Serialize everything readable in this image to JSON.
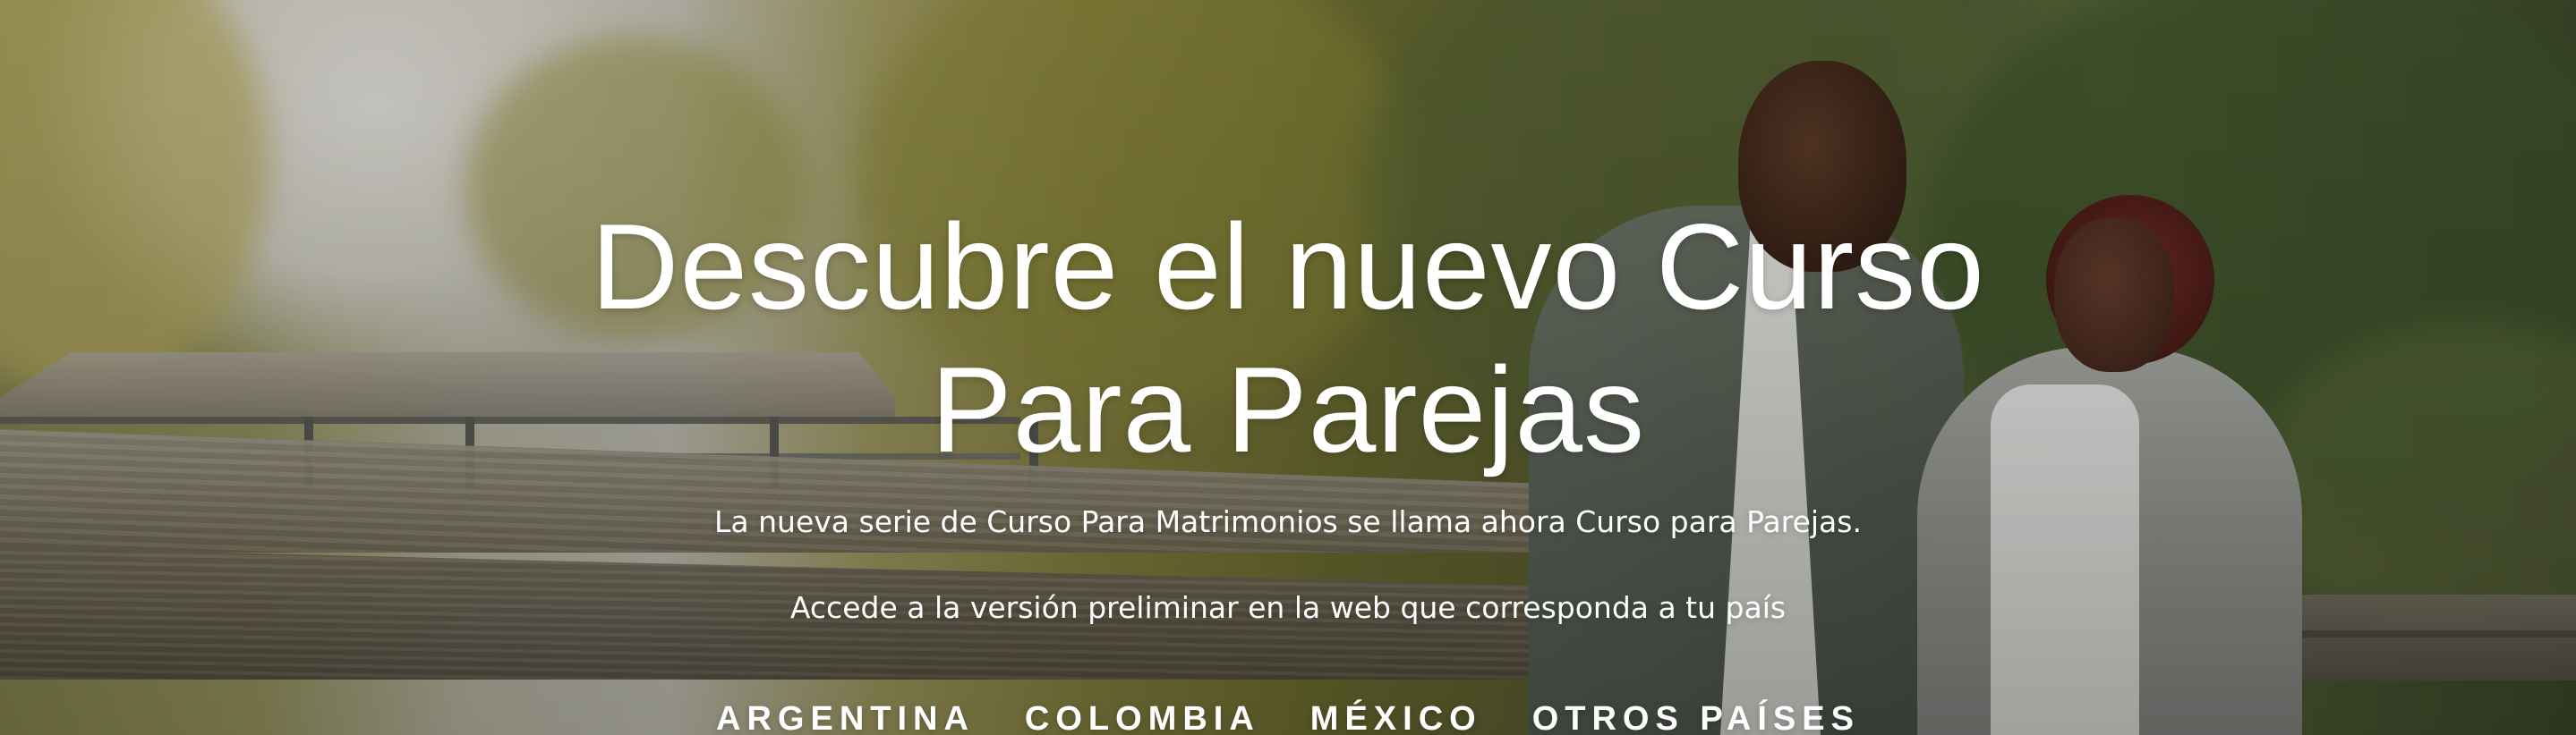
{
  "hero": {
    "title_line_1": "Descubre el nuevo Curso",
    "title_line_2": "Para Parejas",
    "subtitle": "La nueva serie de Curso Para Matrimonios se llama ahora Curso para Parejas.",
    "access_text": "Accede a la versión preliminar en la web que corresponda a tu país"
  },
  "country_links": [
    {
      "label": "ARGENTINA"
    },
    {
      "label": "COLOMBIA"
    },
    {
      "label": "MÉXICO"
    },
    {
      "label": "OTROS PAÍSES"
    }
  ],
  "colors": {
    "text": "#ffffff",
    "overlay": "#000000"
  }
}
